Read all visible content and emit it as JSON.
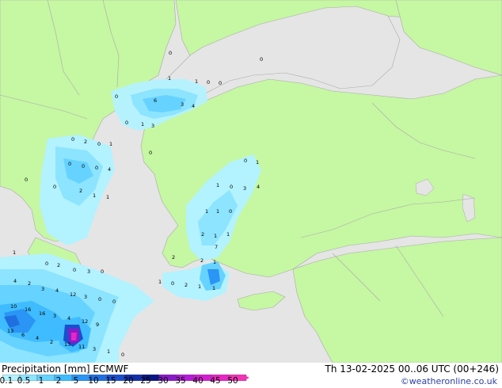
{
  "title": "Precipitation [mm]  ECMWF",
  "valid_time": "Th 13-02-2025 00..06 UTC (00+246)",
  "credit": "©weatheronline.co.uk",
  "colors": {
    "land": "#c6f7a3",
    "sea": "#e5e5e5",
    "border": "#a9a9a9"
  },
  "legend": {
    "ticks": [
      "0.1",
      "0.5",
      "1",
      "2",
      "5",
      "10",
      "15",
      "20",
      "25",
      "30",
      "35",
      "40",
      "45",
      "50"
    ],
    "colors": [
      "#b3f2ff",
      "#8ce4ff",
      "#66d2ff",
      "#3fbcff",
      "#2a95f5",
      "#1f6fe0",
      "#1a4fcc",
      "#1030a8",
      "#0a1683",
      "#8a19c8",
      "#b31cd6",
      "#d21ed2",
      "#e826c4",
      "#f033b5"
    ]
  },
  "value_labels": [
    "0",
    "0",
    "1",
    "1",
    "0",
    "0",
    "0",
    "6",
    "3",
    "4",
    "0",
    "1",
    "3",
    "0",
    "0",
    "2",
    "0",
    "1",
    "0",
    "0",
    "0",
    "4",
    "0",
    "0",
    "2",
    "1",
    "1",
    "0",
    "1",
    "1",
    "0",
    "3",
    "4",
    "1",
    "1",
    "0",
    "2",
    "1",
    "1",
    "1",
    "2",
    "2",
    "1",
    "7",
    "0",
    "2",
    "0",
    "3",
    "0",
    "1",
    "0",
    "2",
    "1",
    "1",
    "4",
    "2",
    "3",
    "4",
    "12",
    "3",
    "0",
    "0",
    "10",
    "16",
    "16",
    "3",
    "4",
    "12",
    "9",
    "13",
    "6",
    "4",
    "2",
    "13",
    "11",
    "3",
    "1",
    "0"
  ]
}
